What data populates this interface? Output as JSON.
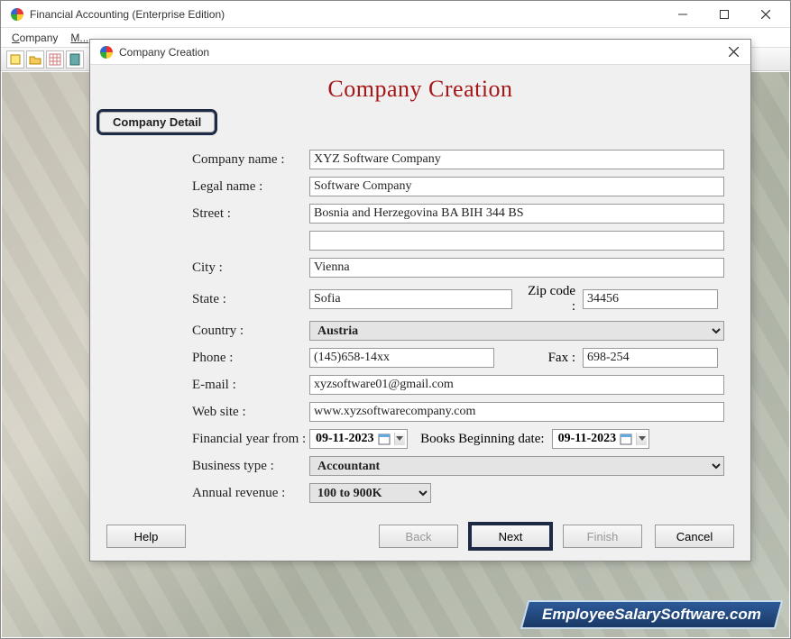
{
  "main": {
    "title": "Financial Accounting (Enterprise Edition)",
    "menubar": [
      "Company",
      "M..."
    ]
  },
  "dialog": {
    "title": "Company Creation",
    "heading": "Company Creation",
    "tab": "Company Detail",
    "labels": {
      "company_name": "Company name :",
      "legal_name": "Legal name :",
      "street": "Street :",
      "city": "City :",
      "state": "State :",
      "zip": "Zip code :",
      "country": "Country :",
      "phone": "Phone :",
      "fax": "Fax :",
      "email": "E-mail :",
      "website": "Web site :",
      "fy_from": "Financial year from :",
      "books_begin": "Books Beginning date:",
      "business_type": "Business type :",
      "annual_revenue": "Annual revenue :"
    },
    "values": {
      "company_name": "XYZ Software Company",
      "legal_name": "Software Company",
      "street1": "Bosnia and Herzegovina BA BIH 344 BS",
      "street2": "",
      "city": "Vienna",
      "state": "Sofia",
      "zip": "34456",
      "country": "Austria",
      "phone": "(145)658-14xx",
      "fax": "698-254",
      "email": "xyzsoftware01@gmail.com",
      "website": "www.xyzsoftwarecompany.com",
      "fy_from": "09-11-2023",
      "books_begin": "09-11-2023",
      "business_type": "Accountant",
      "annual_revenue": "100 to 900K"
    },
    "buttons": {
      "help": "Help",
      "back": "Back",
      "next": "Next",
      "finish": "Finish",
      "cancel": "Cancel"
    }
  },
  "watermark": "EmployeeSalarySoftware.com"
}
